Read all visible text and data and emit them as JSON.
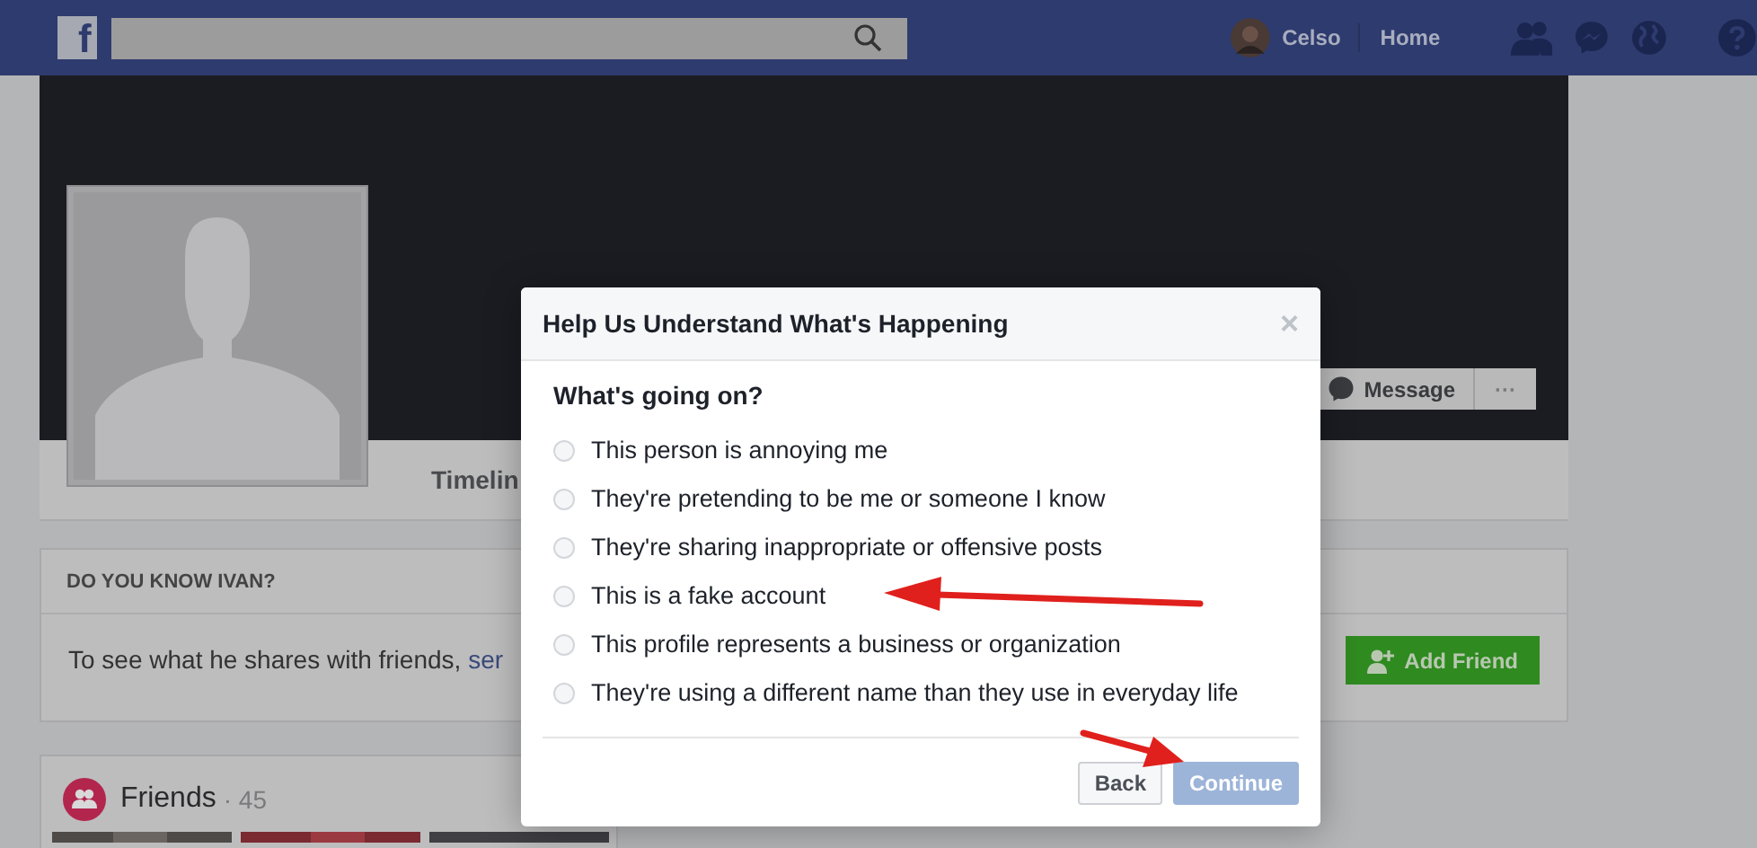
{
  "top_bar": {
    "logo": "f",
    "user": "Celso",
    "home": "Home"
  },
  "profile": {
    "timeline_tab": "Timelin",
    "message_button": "Message",
    "more_button": "···"
  },
  "know_card": {
    "title": "DO YOU KNOW IVAN?",
    "text": "To see what he shares with friends, ",
    "link": "ser",
    "add_friend": "Add Friend"
  },
  "friends_card": {
    "title": "Friends",
    "count": "· 45"
  },
  "dialog": {
    "title": "Help Us Understand What's Happening",
    "close": "×",
    "question": "What's going on?",
    "options": [
      {
        "label": "This person is annoying me",
        "selected": false
      },
      {
        "label": "They're pretending to be me or someone I know",
        "selected": false
      },
      {
        "label": "They're sharing inappropriate or offensive posts",
        "selected": false
      },
      {
        "label": "This is a fake account",
        "selected": false
      },
      {
        "label": "This profile represents a business or organization",
        "selected": false
      },
      {
        "label": "They're using a different name than they use in everyday life",
        "selected": false
      }
    ],
    "buttons": [
      {
        "label": "Back",
        "kind": "secondary",
        "disabled": false
      },
      {
        "label": "Continue",
        "kind": "primary",
        "disabled": true
      }
    ]
  }
}
